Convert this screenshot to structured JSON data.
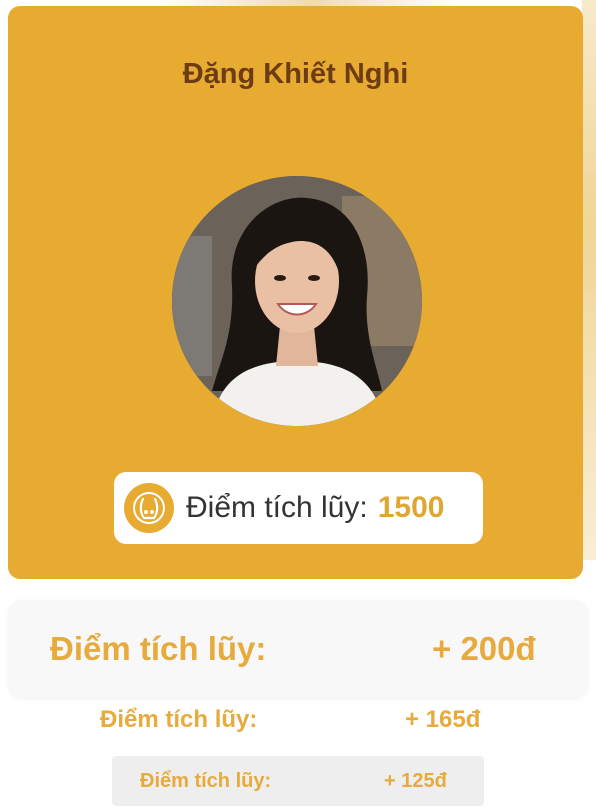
{
  "profile": {
    "name": "Đặng Khiết Nghi",
    "avatar_icon": "user-photo",
    "points_label": "Điểm tích lũy:",
    "points_value": "1500",
    "points_icon": "coin-icon"
  },
  "tiers": [
    {
      "label": "Điểm tích lũy:",
      "value": "+ 200đ"
    },
    {
      "label": "Điểm tích lũy:",
      "value": "+ 165đ"
    },
    {
      "label": "Điểm tích lũy:",
      "value": "+ 125đ"
    }
  ],
  "colors": {
    "card_bg": "#e8ab32",
    "name_text": "#6d3b14",
    "accent": "#e6ab3c"
  }
}
